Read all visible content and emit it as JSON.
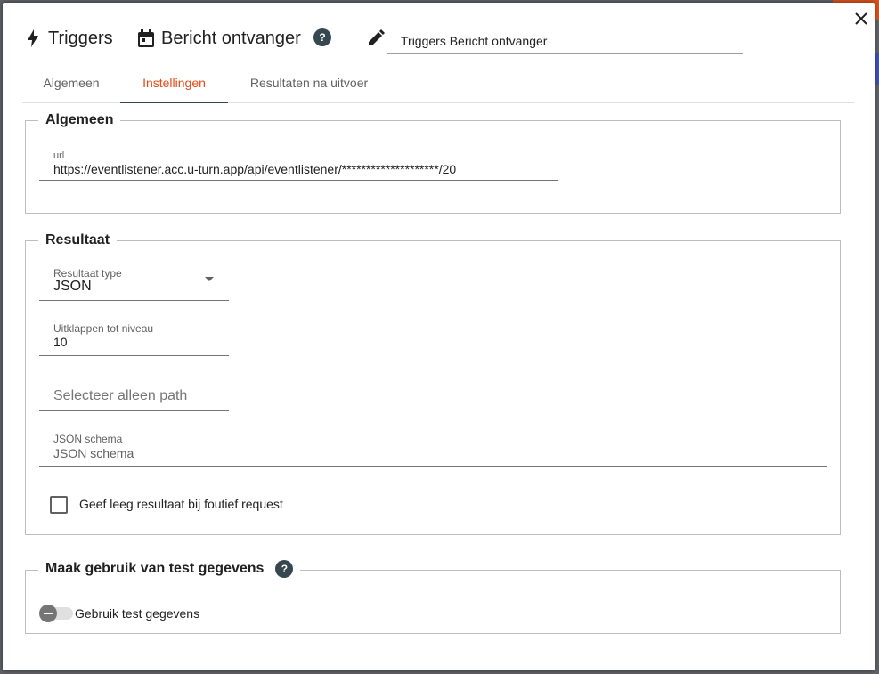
{
  "header": {
    "triggers_label": "Triggers",
    "event_label": "Bericht ontvanger",
    "help_badge": "?",
    "name_value": "Triggers Bericht ontvanger",
    "icons": [
      "bolt-icon",
      "calendar-icon",
      "help-icon",
      "pencil-icon",
      "close-icon"
    ]
  },
  "tabs": [
    {
      "label": "Algemeen",
      "active": false
    },
    {
      "label": "Instellingen",
      "active": true
    },
    {
      "label": "Resultaten na uitvoer",
      "active": false
    }
  ],
  "algemeen": {
    "legend": "Algemeen",
    "url_label": "url",
    "url_value": "https://eventlistener.acc.u-turn.app/api/eventlistener/********************/20"
  },
  "resultaat": {
    "legend": "Resultaat",
    "type_label": "Resultaat type",
    "type_value": "JSON",
    "niveau_label": "Uitklappen tot niveau",
    "niveau_value": "10",
    "path_placeholder": "Selecteer alleen path",
    "schema_label": "JSON schema",
    "schema_placeholder": "JSON schema",
    "checkbox_label": "Geef leeg resultaat bij foutief request",
    "checkbox_checked": false
  },
  "test": {
    "legend": "Maak gebruik van test gegevens",
    "help_badge": "?",
    "toggle_label": "Gebruik test gegevens",
    "toggle_on": false
  },
  "colors": {
    "accent": "#e64a19",
    "tab_indicator": "#37474f",
    "help_badge": "#37474f"
  }
}
